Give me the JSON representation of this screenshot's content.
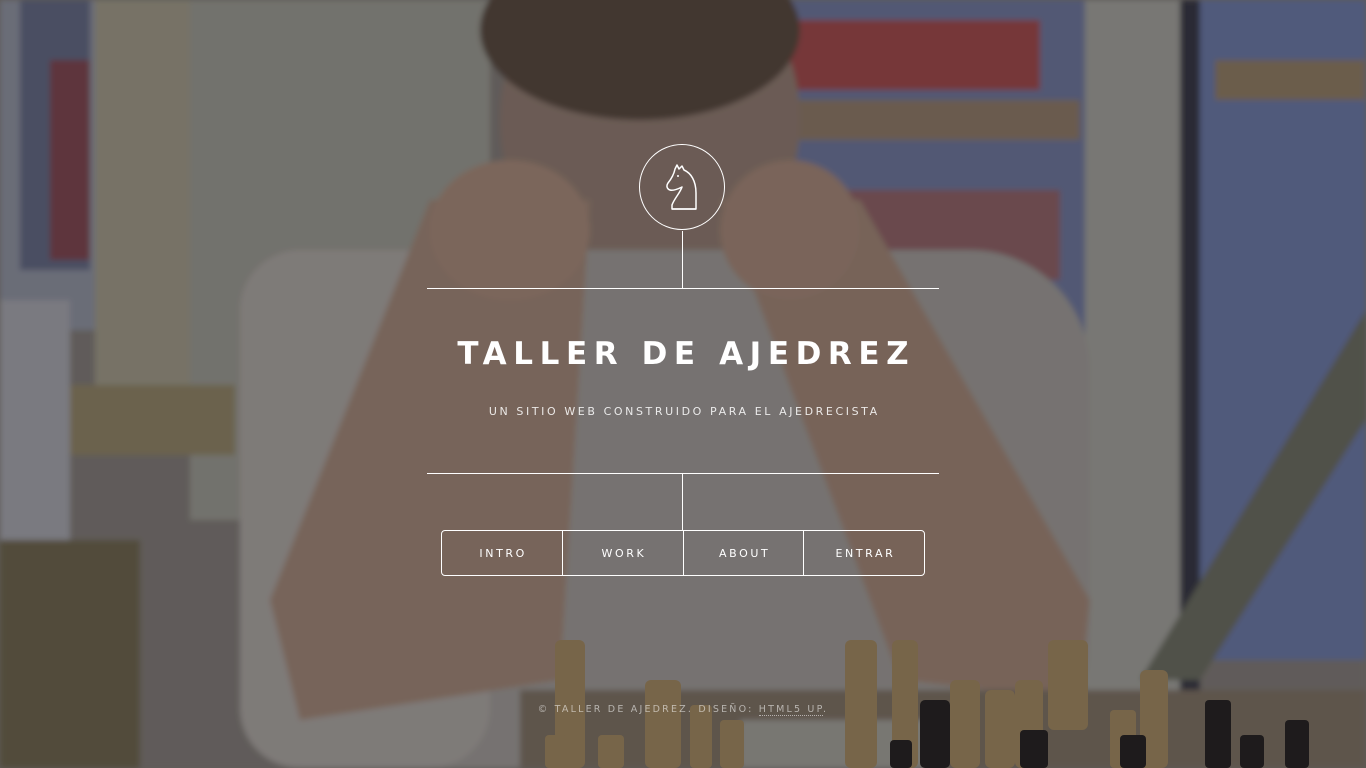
{
  "header": {
    "title": "TALLER DE AJEDREZ",
    "subtitle": "UN SITIO WEB CONSTRUIDO PARA EL AJEDRECISTA"
  },
  "logo": {
    "icon": "chess-knight-icon"
  },
  "nav": {
    "items": [
      {
        "label": "INTRO"
      },
      {
        "label": "WORK"
      },
      {
        "label": "ABOUT"
      },
      {
        "label": "ENTRAR"
      }
    ]
  },
  "footer": {
    "copyright": "© TALLER DE AJEDREZ. DISEÑO:",
    "credit_link": "HTML5 UP",
    "period": "."
  },
  "colors": {
    "line": "#ffffff",
    "text": "#ffffff",
    "overlay": "#1e1c1e"
  }
}
